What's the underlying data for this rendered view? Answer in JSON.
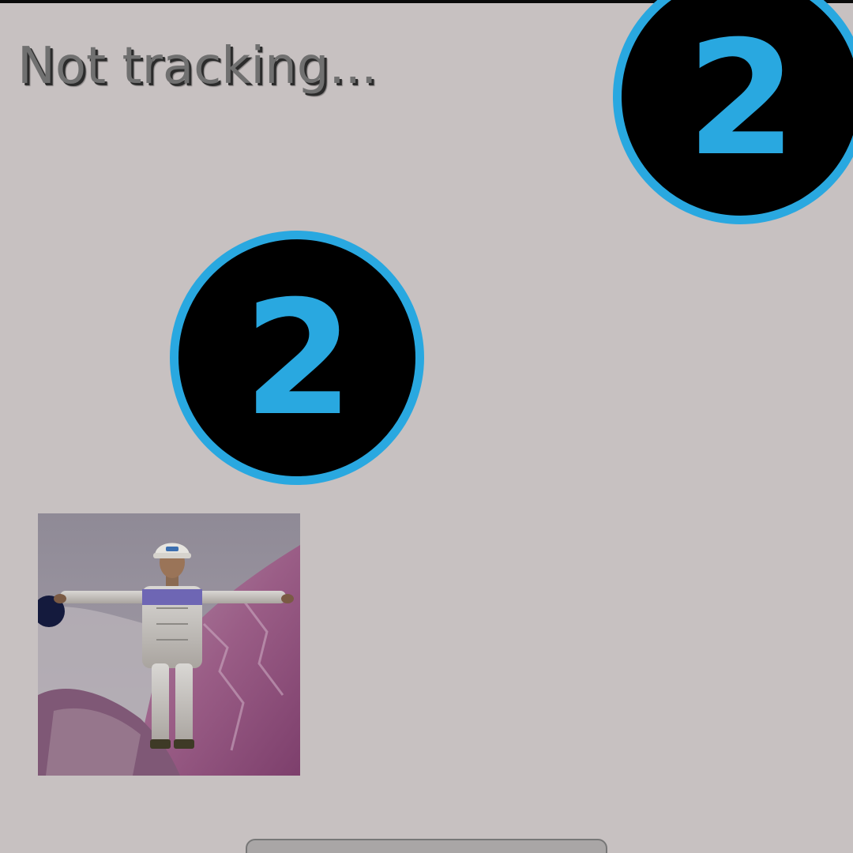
{
  "status": {
    "text": "Not tracking..."
  },
  "badges": [
    {
      "label": "2",
      "icon": "number-badge-icon"
    },
    {
      "label": "2",
      "icon": "number-badge-icon"
    }
  ],
  "thumbnail": {
    "icon": "avatar-worker-icon"
  },
  "colors": {
    "background": "#c7c1c1",
    "badge_fill": "#000000",
    "badge_accent": "#29a8e0",
    "status_text": "#707070"
  }
}
